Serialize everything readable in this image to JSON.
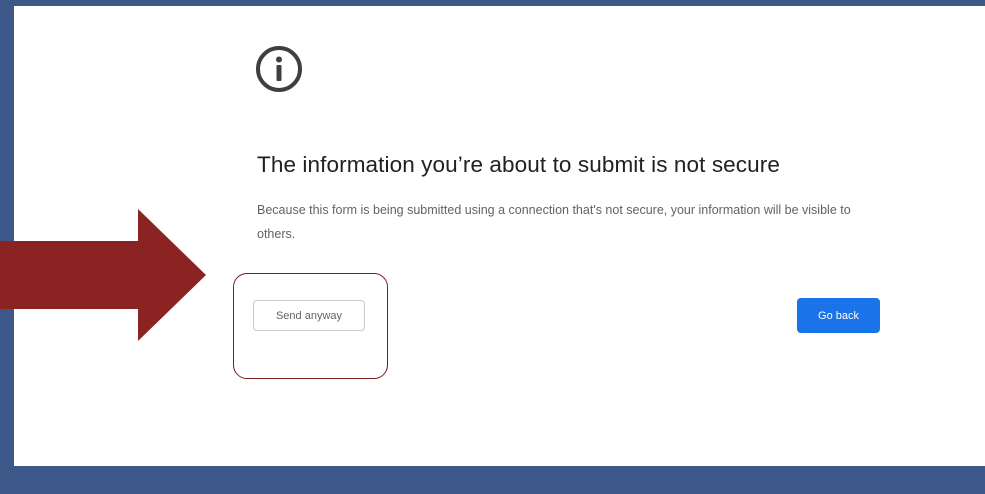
{
  "dialog": {
    "icon": "info-circle-icon",
    "title": "The information you’re about to submit is not secure",
    "description": "Because this form is being submitted using a connection that's not secure, your information will be visible to others.",
    "send_anyway_label": "Send anyway",
    "go_back_label": "Go back"
  },
  "annotation": {
    "arrow_icon": "right-arrow-icon",
    "arrow_color": "#8b2323",
    "highlight_color": "#7a1c1c"
  },
  "colors": {
    "frame": "#3b5888",
    "primary_button": "#1a73e8",
    "title_text": "#202124",
    "body_text": "#5f6368"
  }
}
